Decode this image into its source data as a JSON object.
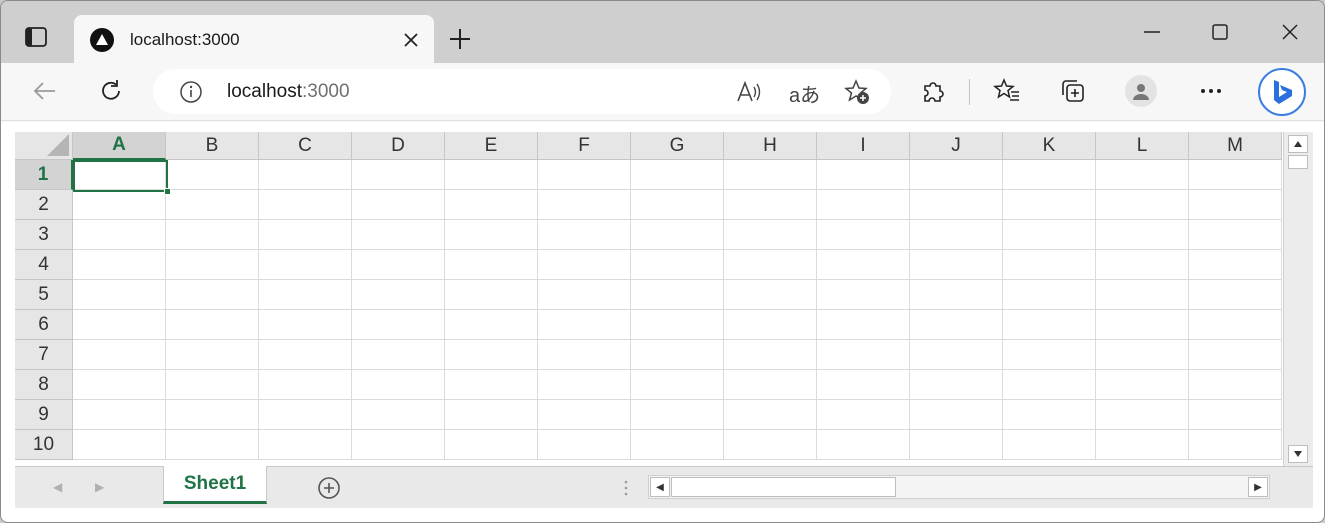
{
  "browser": {
    "tab_title": "localhost:3000",
    "url_host": "localhost",
    "url_port": ":3000",
    "toolbar_icons": [
      "back-icon",
      "refresh-icon",
      "info-icon",
      "read-aloud-icon",
      "translate-icon",
      "add-favorite-icon",
      "extensions-icon",
      "favorites-icon",
      "collections-icon",
      "profile-icon",
      "more-icon",
      "bing-icon"
    ],
    "window_controls": [
      "minimize-icon",
      "maximize-icon",
      "close-icon"
    ]
  },
  "spreadsheet": {
    "columns": [
      "A",
      "B",
      "C",
      "D",
      "E",
      "F",
      "G",
      "H",
      "I",
      "J",
      "K",
      "L",
      "M"
    ],
    "rows": [
      "1",
      "2",
      "3",
      "4",
      "5",
      "6",
      "7",
      "8",
      "9",
      "10"
    ],
    "active_cell": "A1",
    "active_column": "A",
    "active_row": "1",
    "sheet_tabs": [
      "Sheet1"
    ],
    "accent_color": "#217346"
  }
}
